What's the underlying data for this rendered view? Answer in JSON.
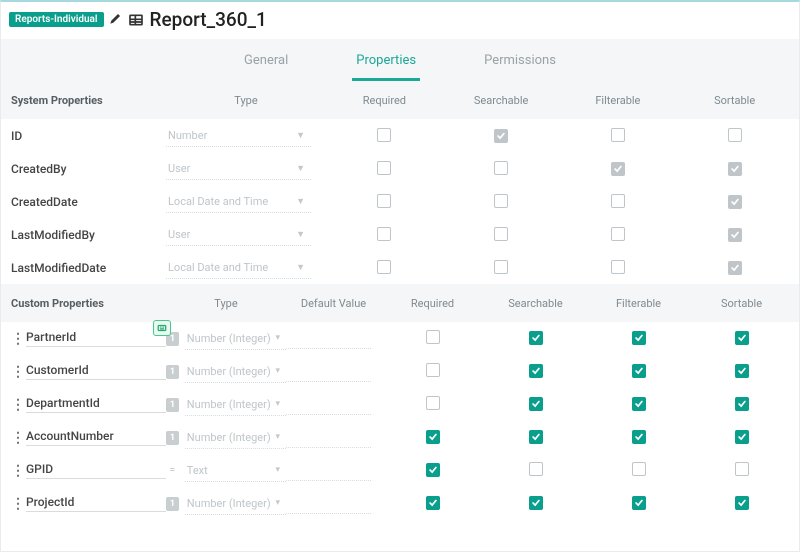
{
  "header": {
    "badge": "Reports-Individual",
    "title": "Report_360_1"
  },
  "tabs": {
    "general": "General",
    "properties": "Properties",
    "permissions": "Permissions",
    "active": "properties"
  },
  "sys_header": {
    "section": "System Properties",
    "type": "Type",
    "required": "Required",
    "searchable": "Searchable",
    "filterable": "Filterable",
    "sortable": "Sortable"
  },
  "sys_rows": [
    {
      "name": "ID",
      "type": "Number",
      "required": false,
      "searchable": "gray",
      "filterable": false,
      "sortable": false
    },
    {
      "name": "CreatedBy",
      "type": "User",
      "required": false,
      "searchable": false,
      "filterable": "gray",
      "sortable": "gray"
    },
    {
      "name": "CreatedDate",
      "type": "Local Date and Time",
      "required": false,
      "searchable": false,
      "filterable": false,
      "sortable": "gray"
    },
    {
      "name": "LastModifiedBy",
      "type": "User",
      "required": false,
      "searchable": false,
      "filterable": false,
      "sortable": "gray"
    },
    {
      "name": "LastModifiedDate",
      "type": "Local Date and Time",
      "required": false,
      "searchable": false,
      "filterable": false,
      "sortable": "gray"
    }
  ],
  "cust_header": {
    "section": "Custom Properties",
    "type": "Type",
    "default": "Default Value",
    "required": "Required",
    "searchable": "Searchable",
    "filterable": "Filterable",
    "sortable": "Sortable"
  },
  "cust_rows": [
    {
      "name": "PartnerId",
      "kind": "num",
      "type": "Number (Integer)",
      "default": "",
      "required": false,
      "searchable": true,
      "filterable": true,
      "sortable": true
    },
    {
      "name": "CustomerId",
      "kind": "num",
      "type": "Number (Integer)",
      "default": "",
      "required": false,
      "searchable": true,
      "filterable": true,
      "sortable": true
    },
    {
      "name": "DepartmentId",
      "kind": "num",
      "type": "Number (Integer)",
      "default": "",
      "required": false,
      "searchable": true,
      "filterable": true,
      "sortable": true
    },
    {
      "name": "AccountNumber",
      "kind": "num",
      "type": "Number (Integer)",
      "default": "",
      "required": true,
      "searchable": true,
      "filterable": true,
      "sortable": true
    },
    {
      "name": "GPID",
      "kind": "text",
      "type": "Text",
      "default": "",
      "required": true,
      "searchable": false,
      "filterable": false,
      "sortable": false
    },
    {
      "name": "ProjectId",
      "kind": "num",
      "type": "Number (Integer)",
      "default": "",
      "required": true,
      "searchable": true,
      "filterable": true,
      "sortable": true
    }
  ]
}
